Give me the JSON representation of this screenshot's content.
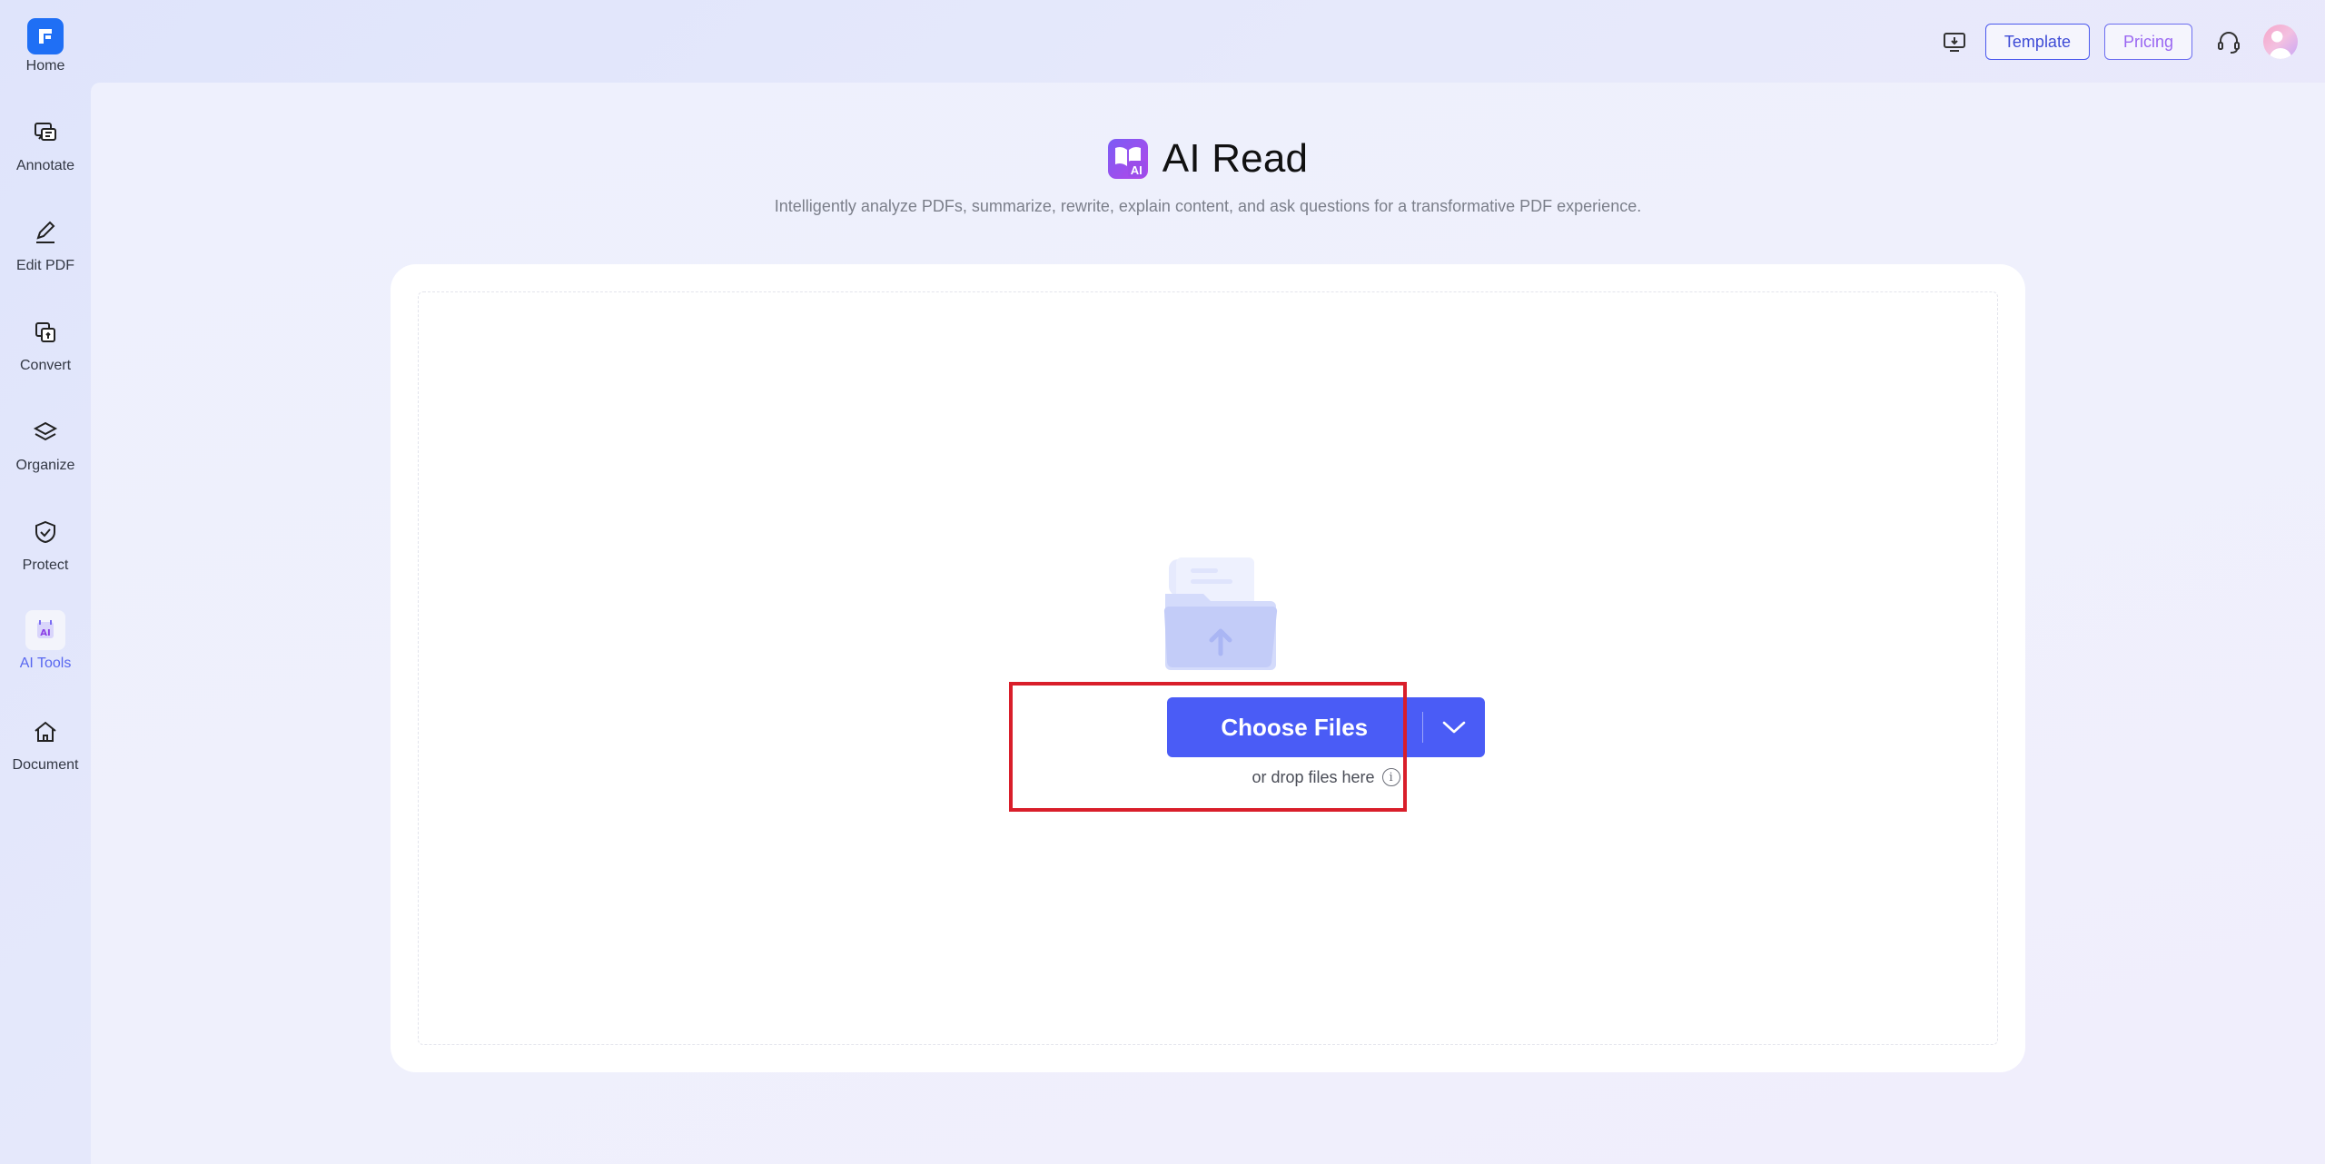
{
  "sidebar": {
    "items": [
      {
        "label": "Home",
        "icon": "home-logo-icon"
      },
      {
        "label": "Annotate",
        "icon": "annotate-icon"
      },
      {
        "label": "Edit PDF",
        "icon": "edit-pdf-icon"
      },
      {
        "label": "Convert",
        "icon": "convert-icon"
      },
      {
        "label": "Organize",
        "icon": "organize-icon"
      },
      {
        "label": "Protect",
        "icon": "protect-icon"
      },
      {
        "label": "AI Tools",
        "icon": "ai-tools-icon",
        "active": true
      },
      {
        "label": "Document",
        "icon": "document-icon"
      }
    ]
  },
  "header": {
    "template_label": "Template",
    "pricing_label": "Pricing",
    "icons": [
      "download-desktop-icon",
      "support-headset-icon",
      "user-avatar"
    ]
  },
  "main": {
    "title": "AI Read",
    "title_icon_text": "AI",
    "subtitle": "Intelligently analyze PDFs, summarize, rewrite, explain content, and ask questions for a transformative PDF experience.",
    "upload": {
      "button_label": "Choose Files",
      "drop_hint": "or drop files here",
      "info_glyph": "i"
    }
  },
  "colors": {
    "accent": "#4a5cf6",
    "brand_blue": "#1f6ff5",
    "active_nav": "#5867f0",
    "highlight": "#d91e2a"
  }
}
